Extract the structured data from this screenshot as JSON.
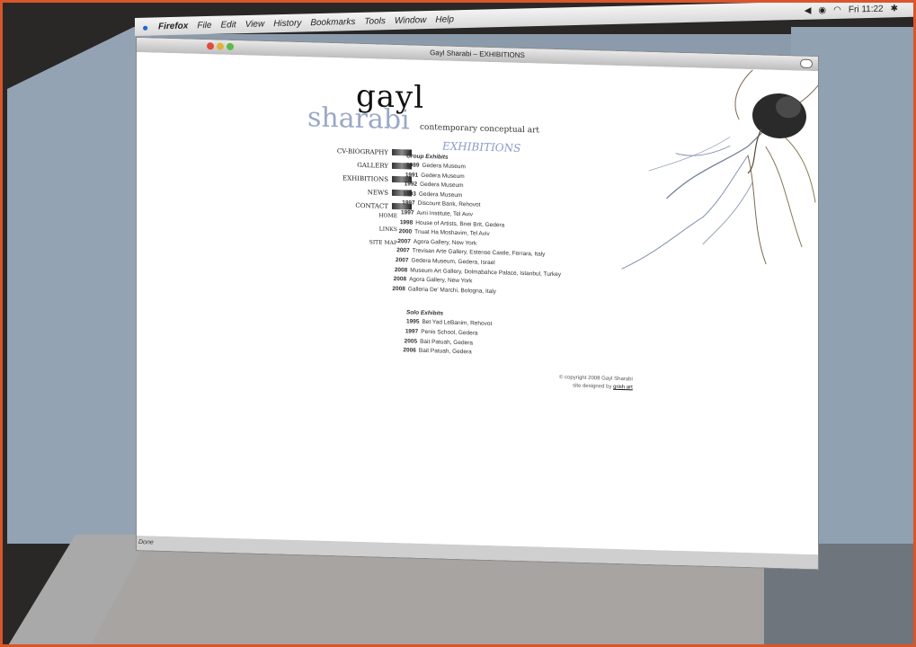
{
  "menubar": {
    "items": [
      "Firefox",
      "File",
      "Edit",
      "View",
      "History",
      "Bookmarks",
      "Tools",
      "Window",
      "Help"
    ],
    "clock": "Fri 11:22"
  },
  "window": {
    "title": "Gayl Sharabi – EXHIBITIONS",
    "status": "Done"
  },
  "site": {
    "logo_first": "gayl",
    "logo_last": "sharabi",
    "tagline": "contemporary conceptual art",
    "heading": "EXHIBITIONS",
    "nav": [
      "CV-BIOGRAPHY",
      "GALLERY",
      "EXHIBITIONS",
      "NEWS",
      "CONTACT"
    ],
    "nav_small": [
      "HOME",
      "LINKS",
      "SITE MAP"
    ],
    "group_title": "Group Exhibits",
    "group": [
      {
        "year": "1989",
        "text": "Gedera Museum"
      },
      {
        "year": "1991",
        "text": "Gedera Museum"
      },
      {
        "year": "1992",
        "text": "Gedera Museum"
      },
      {
        "year": "1993",
        "text": "Gedera Museum"
      },
      {
        "year": "1997",
        "text": "Discount Bank, Rehovot"
      },
      {
        "year": "1997",
        "text": "Avni Institute, Tel Aviv"
      },
      {
        "year": "1998",
        "text": "House of Artists, Bnei Brit, Gedera"
      },
      {
        "year": "2000",
        "text": "Tnuat Ha Moshavim, Tel Aviv"
      },
      {
        "year": "2007",
        "text": "Agora Gallery, New York"
      },
      {
        "year": "2007",
        "text": "Trevisan Arte Gallery, Estense Castle, Ferrara, Italy"
      },
      {
        "year": "2007",
        "text": "Gedera Museum, Gedera, Israel"
      },
      {
        "year": "2008",
        "text": "Museum Art Gallery, Dolmabahce Palace, Istanbul, Turkey"
      },
      {
        "year": "2008",
        "text": "Agora Gallery, New York"
      },
      {
        "year": "2008",
        "text": "Galleria De' Marchi, Bologna, Italy"
      }
    ],
    "solo_title": "Solo Exhibits",
    "solo": [
      {
        "year": "1995",
        "text": "Bet Yad LeBanim, Rehovot"
      },
      {
        "year": "1997",
        "text": "Penis School, Gedera"
      },
      {
        "year": "2005",
        "text": "Bait Patuah, Gedera"
      },
      {
        "year": "2006",
        "text": "Bait Patuah, Gedera"
      }
    ],
    "copyright": "© copyright 2008 Gayl Sharabi",
    "designed_by": "site designed by",
    "designer": "grish art"
  }
}
